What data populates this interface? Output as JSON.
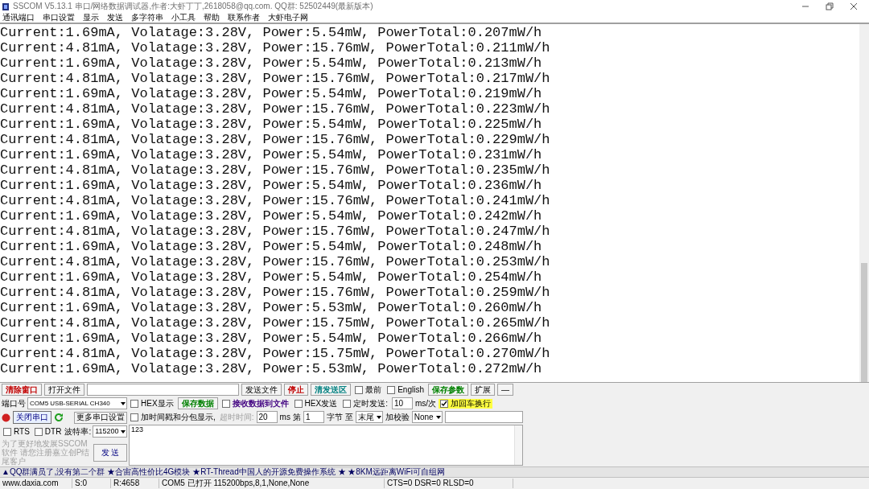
{
  "window": {
    "title": "SSCOM V5.13.1 串口/网络数据调试器,作者:大虾丁丁,2618058@qq.com. QQ群:  52502449(最新版本)"
  },
  "menu": [
    "通讯端口",
    "串口设置",
    "显示",
    "发送",
    "多字符串",
    "小工具",
    "帮助",
    "联系作者",
    "大虾电子网"
  ],
  "log": [
    "Current:1.69mA, Volatage:3.28V, Power:5.54mW, PowerTotal:0.207mW/h",
    "Current:4.81mA, Volatage:3.28V, Power:15.76mW, PowerTotal:0.211mW/h",
    "Current:1.69mA, Volatage:3.28V, Power:5.54mW, PowerTotal:0.213mW/h",
    "Current:4.81mA, Volatage:3.28V, Power:15.76mW, PowerTotal:0.217mW/h",
    "Current:1.69mA, Volatage:3.28V, Power:5.54mW, PowerTotal:0.219mW/h",
    "Current:4.81mA, Volatage:3.28V, Power:15.76mW, PowerTotal:0.223mW/h",
    "Current:1.69mA, Volatage:3.28V, Power:5.54mW, PowerTotal:0.225mW/h",
    "Current:4.81mA, Volatage:3.28V, Power:15.76mW, PowerTotal:0.229mW/h",
    "Current:1.69mA, Volatage:3.28V, Power:5.54mW, PowerTotal:0.231mW/h",
    "Current:4.81mA, Volatage:3.28V, Power:15.76mW, PowerTotal:0.235mW/h",
    "Current:1.69mA, Volatage:3.28V, Power:5.54mW, PowerTotal:0.236mW/h",
    "Current:4.81mA, Volatage:3.28V, Power:15.76mW, PowerTotal:0.241mW/h",
    "Current:1.69mA, Volatage:3.28V, Power:5.54mW, PowerTotal:0.242mW/h",
    "Current:4.81mA, Volatage:3.28V, Power:15.76mW, PowerTotal:0.247mW/h",
    "Current:1.69mA, Volatage:3.28V, Power:5.54mW, PowerTotal:0.248mW/h",
    "Current:4.81mA, Volatage:3.28V, Power:15.76mW, PowerTotal:0.253mW/h",
    "Current:1.69mA, Volatage:3.28V, Power:5.54mW, PowerTotal:0.254mW/h",
    "Current:4.81mA, Volatage:3.28V, Power:15.76mW, PowerTotal:0.259mW/h",
    "Current:1.69mA, Volatage:3.28V, Power:5.53mW, PowerTotal:0.260mW/h",
    "Current:4.81mA, Volatage:3.28V, Power:15.75mW, PowerTotal:0.265mW/h",
    "Current:1.69mA, Volatage:3.28V, Power:5.54mW, PowerTotal:0.266mW/h",
    "Current:4.81mA, Volatage:3.28V, Power:15.75mW, PowerTotal:0.270mW/h",
    "Current:1.69mA, Volatage:3.28V, Power:5.53mW, PowerTotal:0.272mW/h"
  ],
  "toolbar": [
    {
      "kind": "button",
      "label": "清除窗口",
      "color": "#c00000"
    },
    {
      "kind": "button",
      "label": "打开文件"
    },
    {
      "kind": "input"
    },
    {
      "kind": "button",
      "label": "发送文件"
    },
    {
      "kind": "button",
      "label": "停止",
      "color": "#c00000"
    },
    {
      "kind": "button",
      "label": "清发送区",
      "color": "#008080"
    },
    {
      "kind": "checkbox",
      "label": "最前",
      "checked": false
    },
    {
      "kind": "checkbox",
      "label": "English",
      "checked": false
    },
    {
      "kind": "button",
      "label": "保存参数",
      "color": "#008000"
    },
    {
      "kind": "button",
      "label": "扩展"
    },
    {
      "kind": "button",
      "label": "—"
    }
  ],
  "port": {
    "label": "端口号",
    "value": "COM5 USB-SERIAL CH340",
    "open": true,
    "toggle_button": "关闭串口",
    "more_button": "更多串口设置"
  },
  "rts": {
    "label": "RTS",
    "checked": false
  },
  "dtr": {
    "label": "DTR",
    "checked": false
  },
  "baud": {
    "label": "波特率:",
    "value": "115200"
  },
  "promo": "为了更好地发展SSCOM软件 请您注册嘉立创P结尾客户",
  "send_button": "发 送",
  "options_rows": [
    {
      "items": [
        {
          "kind": "checkbox",
          "label": "HEX显示",
          "checked": false
        },
        {
          "kind": "button",
          "label": "保存数据",
          "color": "#008000"
        },
        {
          "kind": "checkbox",
          "label": "接收数据到文件",
          "checked": false,
          "color": "#400080"
        },
        {
          "kind": "checkbox",
          "label": "HEX发送",
          "checked": false
        },
        {
          "kind": "checkbox",
          "label": "定时发送:",
          "checked": false
        },
        {
          "kind": "input",
          "value": "10"
        },
        {
          "kind": "label",
          "label": "ms/次"
        },
        {
          "kind": "checkbox",
          "label": "加回车换行",
          "checked": true,
          "highlighted": true
        }
      ]
    },
    {
      "items": [
        {
          "kind": "checkbox",
          "label": "加时间戳和分包显示,",
          "checked": false
        },
        {
          "kind": "label",
          "label": "超时时间:",
          "disabled": true
        },
        {
          "kind": "input",
          "value": "20"
        },
        {
          "kind": "label",
          "label": "ms"
        },
        {
          "kind": "label",
          "label": "第"
        },
        {
          "kind": "input",
          "value": "1"
        },
        {
          "kind": "label",
          "label": "字节 至"
        },
        {
          "kind": "select",
          "value": "末尾"
        },
        {
          "kind": "label",
          "label": "加校验"
        },
        {
          "kind": "select",
          "value": "None"
        },
        {
          "kind": "input"
        }
      ]
    }
  ],
  "send_text": "123",
  "ticker": "▲QQ群满员了,没有第二个群 ★合宙高性价比4G模块 ★RT-Thread中国人的开源免费操作系统 ★ ★8KM远距离WiFi可自组网",
  "status_bar": [
    "www.daxia.com",
    "S:0",
    "R:4658",
    "COM5 已打开  115200bps,8,1,None,None",
    "CTS=0 DSR=0 RLSD=0"
  ]
}
